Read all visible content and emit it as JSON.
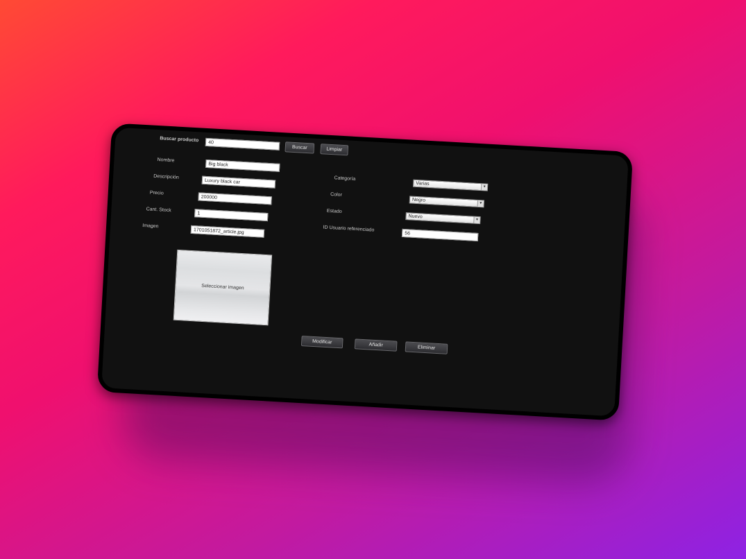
{
  "search": {
    "label": "Buscar producto",
    "value": "40",
    "search_button": "Buscar",
    "clear_button": "Limpiar"
  },
  "form": {
    "name_label": "Nombre",
    "name_value": "Big black",
    "description_label": "Descripción",
    "description_value": "Luxury black car",
    "price_label": "Precio",
    "price_value": "200000",
    "stock_label": "Cant. Stock",
    "stock_value": "1",
    "image_label": "Imagen",
    "image_value": "1701051872_article.jpg",
    "select_image_button": "Seleccionar imagen",
    "category_label": "Categoría",
    "category_value": "Varias",
    "color_label": "Color",
    "color_value": "Negro",
    "state_label": "Estado",
    "state_value": "Nuevo",
    "user_label": "ID Usuario referenciado",
    "user_value": "56"
  },
  "actions": {
    "modify": "Modificar",
    "add": "Añadir",
    "delete": "Eliminar"
  },
  "colors": {
    "background_start": "#ff4a34",
    "background_end": "#8e22e4",
    "panel": "#111111",
    "bezel": "#000000"
  }
}
